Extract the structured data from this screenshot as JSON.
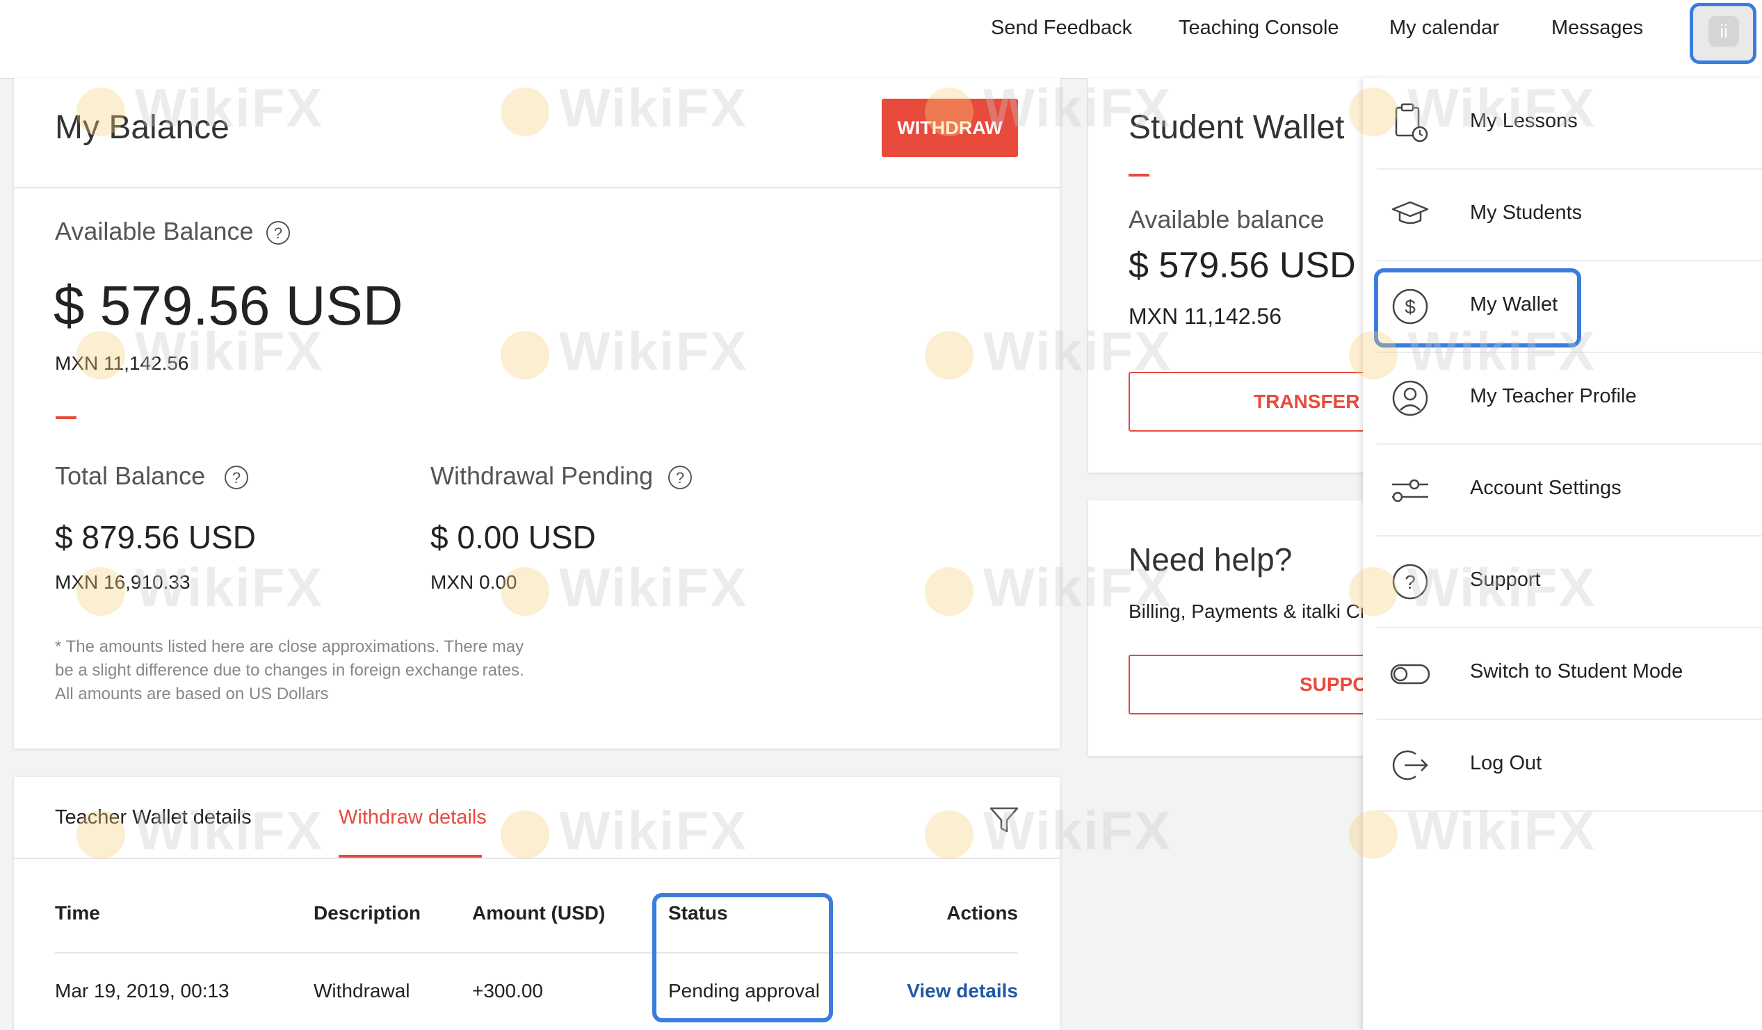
{
  "nav": {
    "send_feedback": "Send Feedback",
    "teaching_console": "Teaching Console",
    "my_calendar": "My calendar",
    "messages": "Messages",
    "avatar_glyph": "ii"
  },
  "balance": {
    "title": "My Balance",
    "withdraw_label": "WITHDRAW",
    "available_label": "Available Balance",
    "available_usd": "$ 579.56 USD",
    "available_mxn": "MXN 11,142.56",
    "total_label": "Total Balance",
    "total_usd": "$ 879.56 USD",
    "total_mxn": "MXN 16,910.33",
    "pending_label": "Withdrawal Pending",
    "pending_usd": "$ 0.00 USD",
    "pending_mxn": "MXN 0.00",
    "help_glyph": "?",
    "note_line1": "* The amounts listed here are close approximations. There may",
    "note_line2": "be a slight difference due to changes in foreign exchange rates.",
    "note_line3": "All amounts are based on US Dollars"
  },
  "student_wallet": {
    "title": "Student Wallet",
    "available_label": "Available balance",
    "usd": "$ 579.56 USD",
    "mxn": "MXN 11,142.56",
    "transfer_label": "TRANSFER C"
  },
  "help_card": {
    "title": "Need help?",
    "subtitle": "Billing, Payments & italki Cr",
    "support_label": "SUPPO"
  },
  "details": {
    "tabs": [
      {
        "label": "Teacher Wallet details",
        "active": false
      },
      {
        "label": "Withdraw details",
        "active": true
      }
    ],
    "columns": [
      "Time",
      "Description",
      "Amount (USD)",
      "Status",
      "Actions"
    ],
    "rows": [
      {
        "time": "Mar 19, 2019, 00:13",
        "description": "Withdrawal",
        "amount": "+300.00",
        "status": "Pending approval",
        "action": "View details"
      }
    ]
  },
  "menu": {
    "items": [
      {
        "label": "My Lessons",
        "icon": "clipboard-clock-icon"
      },
      {
        "label": "My Students",
        "icon": "graduation-cap-icon"
      },
      {
        "label": "My Wallet",
        "icon": "dollar-circle-icon"
      },
      {
        "label": "My Teacher Profile",
        "icon": "user-circle-icon"
      },
      {
        "label": "Account Settings",
        "icon": "sliders-icon"
      },
      {
        "label": "Support",
        "icon": "question-circle-icon"
      },
      {
        "label": "Switch to Student Mode",
        "icon": "toggle-icon"
      },
      {
        "label": "Log Out",
        "icon": "logout-icon"
      }
    ]
  },
  "watermark": {
    "text": "WikiFX"
  },
  "colors": {
    "accent": "#e84a3c",
    "highlight": "#3b7ddd",
    "link": "#1e58a8"
  }
}
